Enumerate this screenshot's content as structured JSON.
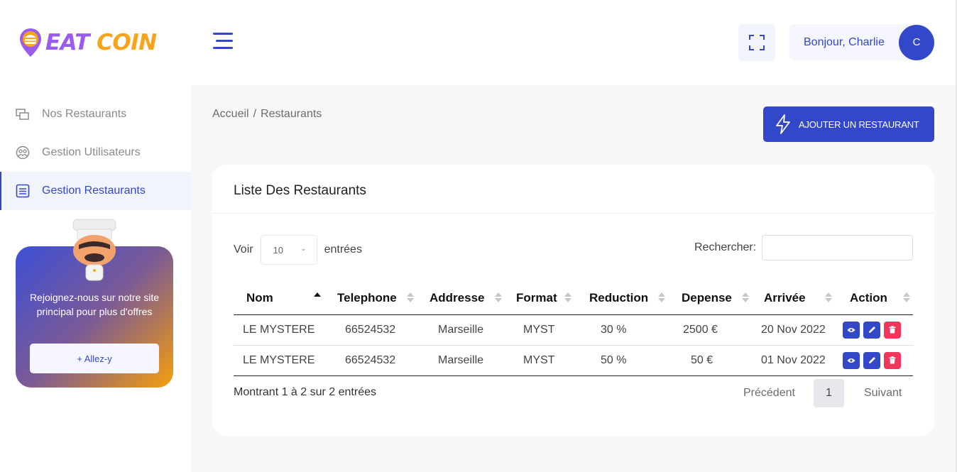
{
  "brand": {
    "part1": "EAT",
    "part2": "COIN"
  },
  "sidebar": {
    "items": [
      {
        "label": "Nos Restaurants",
        "icon": "restaurants-icon",
        "active": false
      },
      {
        "label": "Gestion Utilisateurs",
        "icon": "users-icon",
        "active": false
      },
      {
        "label": "Gestion Restaurants",
        "icon": "list-icon",
        "active": true
      }
    ],
    "promo": {
      "text": "Rejoignez-nous sur notre site principal pour plus d'offres",
      "button": "+ Allez-y"
    }
  },
  "header": {
    "greeting": "Bonjour, Charlie",
    "avatar_initial": "C"
  },
  "breadcrumb": {
    "home": "Accueil",
    "separator": "/",
    "current": "Restaurants"
  },
  "add_button": "AJOUTER UN RESTAURANT",
  "card": {
    "title": "Liste Des Restaurants",
    "length": {
      "prefix": "Voir",
      "value": "10",
      "suffix": "entrées"
    },
    "search": {
      "label": "Rechercher:",
      "value": ""
    },
    "columns": [
      "Nom",
      "Telephone",
      "Addresse",
      "Format",
      "Reduction",
      "Depense",
      "Arrivée",
      "Action"
    ],
    "rows": [
      {
        "nom": "LE MYSTERE",
        "telephone": "66524532",
        "adresse": "Marseille",
        "format": "MYST",
        "reduction": "30 %",
        "depense": "2500 €",
        "arrivee": "20 Nov 2022"
      },
      {
        "nom": "LE MYSTERE",
        "telephone": "66524532",
        "adresse": "Marseille",
        "format": "MYST",
        "reduction": "50 %",
        "depense": "50 €",
        "arrivee": "01 Nov 2022"
      }
    ],
    "info": "Montrant 1 à 2 sur 2 entrées",
    "pagination": {
      "prev": "Précédent",
      "current": "1",
      "next": "Suivant"
    }
  },
  "colors": {
    "primary": "#3347c9",
    "danger": "#f0365a",
    "brand_purple": "#9a5cf0",
    "brand_orange": "#f7a41c"
  }
}
